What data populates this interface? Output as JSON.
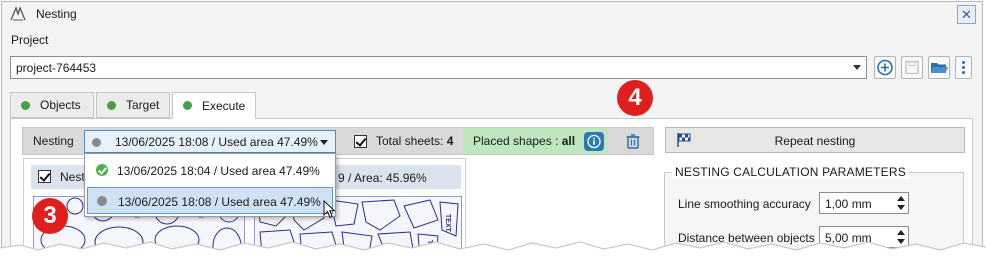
{
  "window": {
    "title": "Nesting",
    "app_icon": "nesting-app-icon",
    "close_icon": "close-icon"
  },
  "project": {
    "label": "Project",
    "value": "project-764453",
    "buttons": [
      "add-circle-icon",
      "save-icon",
      "open-folder-icon",
      "more-vert-icon"
    ]
  },
  "tabs": [
    {
      "label": "Objects",
      "status_color": "#46a046"
    },
    {
      "label": "Target",
      "status_color": "#46a046"
    },
    {
      "label": "Execute",
      "status_color": "#46a046",
      "selected": true
    }
  ],
  "annotations": {
    "badge_a": "4",
    "badge_b": "3",
    "badge_color": "#e01e1e"
  },
  "nesting_bar": {
    "label": "Nesting",
    "selected": "13/06/2025 18:08 / Used area 47.49%",
    "total_sheets_label": "Total sheets:",
    "total_sheets_value": "4",
    "total_sheets_checked": true,
    "placed_label": "Placed shapes :",
    "placed_value": "all",
    "placed_bg": "#bfe6bf"
  },
  "dropdown": {
    "items": [
      {
        "text": "13/06/2025 18:04 / Used area 47.49%",
        "icon": "check-circle-icon"
      },
      {
        "text": "13/06/2025 18:08 / Used area 47.49%",
        "icon": "grey-dot-icon",
        "highlighted": true
      }
    ]
  },
  "sheet": {
    "header_left": "Nest",
    "header_right": "9 / Area: 45.96%",
    "checked": true
  },
  "repeat_button": {
    "label": "Repeat nesting",
    "icon": "checkered-flag-icon"
  },
  "params": {
    "title": "NESTING CALCULATION PARAMETERS",
    "rows": [
      {
        "label": "Line smoothing accuracy",
        "value": "1,00 mm"
      },
      {
        "label": "Distance between objects",
        "value": "5,00 mm"
      }
    ]
  }
}
